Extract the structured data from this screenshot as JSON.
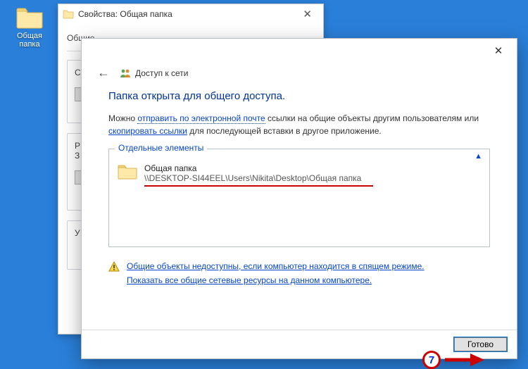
{
  "desktop": {
    "icon_label": "Общая\nпапка"
  },
  "props_window": {
    "title": "Свойства: Общая папка",
    "tab": "Общие",
    "section1_letter": "С",
    "section2_letter": "Р",
    "section2_letter2": "З",
    "section3_letter": "У"
  },
  "share_window": {
    "header_label": "Доступ к сети",
    "heading": "Папка открыта для общего доступа.",
    "desc_prefix": "Можно ",
    "desc_link1": "отправить по электронной почте",
    "desc_mid": " ссылки на общие объекты другим пользователям или ",
    "desc_link2": "скопировать ссылки",
    "desc_suffix": " для последующей вставки в другое приложение.",
    "group_legend": "Отдельные элементы",
    "item_name": "Общая папка",
    "item_path": "\\\\DESKTOP-SI44EEL\\Users\\Nikita\\Desktop\\Общая папка",
    "warn_link1": "Общие объекты недоступны, если компьютер находится в спящем режиме.",
    "warn_link2": "Показать все общие сетевые ресурсы на данном компьютере.",
    "done_label": "Готово"
  },
  "annotation": {
    "step_number": "7"
  },
  "colors": {
    "link": "#0645cc",
    "heading": "#003399",
    "underline": "#cc0000",
    "desktop_bg": "#2a7fd9"
  }
}
